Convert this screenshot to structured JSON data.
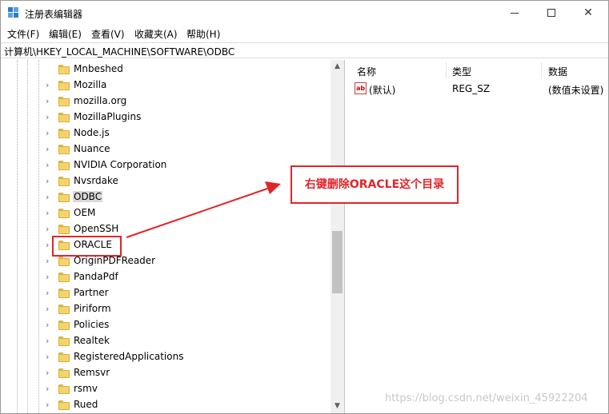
{
  "window": {
    "title": "注册表编辑器"
  },
  "menu": [
    "文件(F)",
    "编辑(E)",
    "查看(V)",
    "收藏夹(A)",
    "帮助(H)"
  ],
  "address": "计算机\\HKEY_LOCAL_MACHINE\\SOFTWARE\\ODBC",
  "tree": {
    "items": [
      {
        "label": "Mnbeshed",
        "selected": false
      },
      {
        "label": "Mozilla",
        "selected": false
      },
      {
        "label": "mozilla.org",
        "selected": false
      },
      {
        "label": "MozillaPlugins",
        "selected": false
      },
      {
        "label": "Node.js",
        "selected": false
      },
      {
        "label": "Nuance",
        "selected": false
      },
      {
        "label": "NVIDIA Corporation",
        "selected": false
      },
      {
        "label": "Nvsrdake",
        "selected": false
      },
      {
        "label": "ODBC",
        "selected": true
      },
      {
        "label": "OEM",
        "selected": false
      },
      {
        "label": "OpenSSH",
        "selected": false
      },
      {
        "label": "ORACLE",
        "selected": false
      },
      {
        "label": "OriginPDFReader",
        "selected": false
      },
      {
        "label": "PandaPdf",
        "selected": false
      },
      {
        "label": "Partner",
        "selected": false
      },
      {
        "label": "Piriform",
        "selected": false
      },
      {
        "label": "Policies",
        "selected": false
      },
      {
        "label": "Realtek",
        "selected": false
      },
      {
        "label": "RegisteredApplications",
        "selected": false
      },
      {
        "label": "Remsvr",
        "selected": false
      },
      {
        "label": "rsmv",
        "selected": false
      },
      {
        "label": "Rued",
        "selected": false
      }
    ]
  },
  "values": {
    "columns": [
      "名称",
      "类型",
      "数据"
    ],
    "rows": [
      {
        "name": "(默认)",
        "type": "REG_SZ",
        "data": "(数值未设置)",
        "icon": "ab-string-icon"
      }
    ]
  },
  "annotation": {
    "callout_text": "右键删除ORACLE这个目录",
    "color": "#e0262a"
  },
  "watermark": "https://blog.csdn.net/weixin_45922204"
}
